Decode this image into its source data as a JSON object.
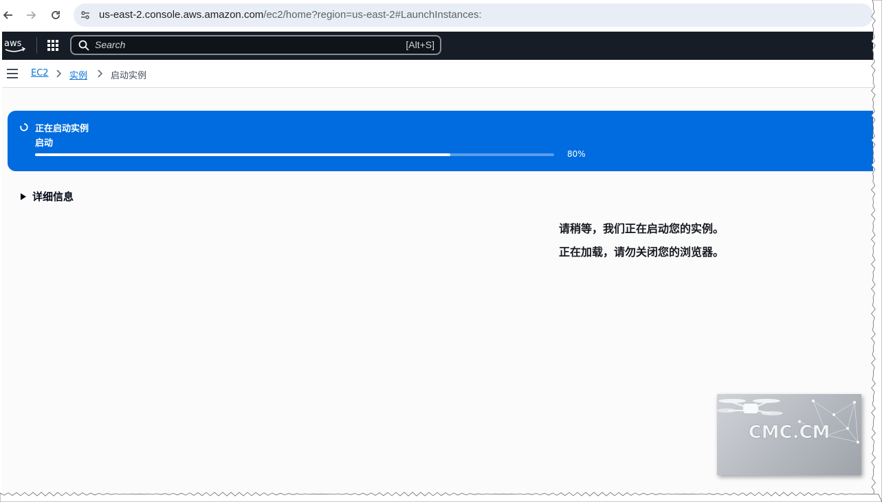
{
  "browser": {
    "url_host": "us-east-2.console.aws.amazon.com",
    "url_path": "/ec2/home?region=us-east-2#LaunchInstances:"
  },
  "aws_nav": {
    "logo_text": "aws",
    "search_placeholder": "Search",
    "search_shortcut": "[Alt+S]"
  },
  "breadcrumb": {
    "items": [
      {
        "label": "EC2",
        "link": true
      },
      {
        "label": "实例",
        "link": true
      },
      {
        "label": "启动实例",
        "link": false
      }
    ]
  },
  "flash": {
    "title": "正在启动实例",
    "subtitle": "启动",
    "progress": 0.8,
    "progress_label": "80%",
    "color": "#006ce0"
  },
  "details": {
    "label": "详细信息"
  },
  "message": {
    "line1": "请稍等，我们正在启动您的实例。",
    "line2": "正在加载，请勿关闭您的浏览器。"
  },
  "watermark": {
    "text": "CMC.CM"
  }
}
